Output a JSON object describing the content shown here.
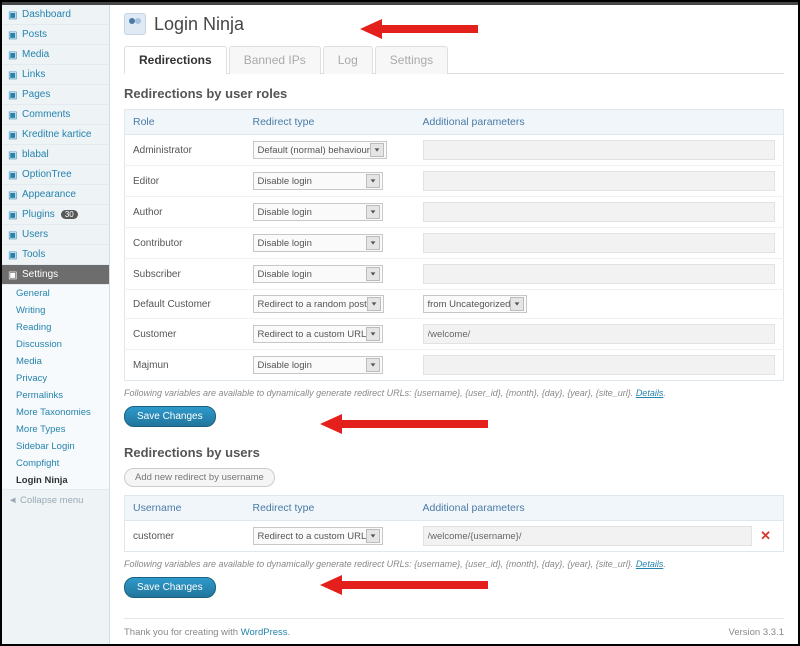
{
  "sidebar": {
    "items": [
      {
        "label": "Dashboard",
        "icon": "home-icon"
      },
      {
        "label": "Posts",
        "icon": "pin-icon"
      },
      {
        "label": "Media",
        "icon": "media-icon"
      },
      {
        "label": "Links",
        "icon": "link-icon"
      },
      {
        "label": "Pages",
        "icon": "page-icon"
      },
      {
        "label": "Comments",
        "icon": "comment-icon"
      },
      {
        "label": "Kreditne kartice",
        "icon": "card-icon"
      },
      {
        "label": "blabal",
        "icon": "generic-icon"
      },
      {
        "label": "OptionTree",
        "icon": "tree-icon"
      },
      {
        "label": "Appearance",
        "icon": "appearance-icon"
      },
      {
        "label": "Plugins",
        "icon": "plugin-icon",
        "badge": "30"
      },
      {
        "label": "Users",
        "icon": "users-icon"
      },
      {
        "label": "Tools",
        "icon": "tools-icon"
      },
      {
        "label": "Settings",
        "icon": "settings-icon",
        "active": true
      }
    ],
    "subitems": [
      "General",
      "Writing",
      "Reading",
      "Discussion",
      "Media",
      "Privacy",
      "Permalinks",
      "More Taxonomies",
      "More Types",
      "Sidebar Login",
      "Compfight",
      "Login Ninja"
    ],
    "subitem_current_index": 11,
    "collapse_label": "Collapse menu"
  },
  "page": {
    "title": "Login Ninja"
  },
  "tabs": [
    "Redirections",
    "Banned IPs",
    "Log",
    "Settings"
  ],
  "active_tab_index": 0,
  "section_roles": {
    "heading": "Redirections by user roles",
    "columns": {
      "role": "Role",
      "type": "Redirect type",
      "params": "Additional parameters"
    },
    "rows": [
      {
        "role": "Administrator",
        "type": "Default (normal) behaviour",
        "param": ""
      },
      {
        "role": "Editor",
        "type": "Disable login",
        "param": ""
      },
      {
        "role": "Author",
        "type": "Disable login",
        "param": ""
      },
      {
        "role": "Contributor",
        "type": "Disable login",
        "param": ""
      },
      {
        "role": "Subscriber",
        "type": "Disable login",
        "param": ""
      },
      {
        "role": "Default Customer",
        "type": "Redirect to a random post",
        "param": "from Uncategorized",
        "param_is_select": true
      },
      {
        "role": "Customer",
        "type": "Redirect to a custom URL",
        "param": "/welcome/"
      },
      {
        "role": "Majmun",
        "type": "Disable login",
        "param": ""
      }
    ],
    "hint_prefix": "Following variables are available to dynamically generate redirect URLs: {username}, {user_id}, {month}, {day}, {year}, {site_url}. ",
    "hint_link": "Details",
    "save_label": "Save Changes"
  },
  "section_users": {
    "heading": "Redirections by users",
    "add_btn": "Add new redirect by username",
    "columns": {
      "user": "Username",
      "type": "Redirect type",
      "params": "Additional parameters"
    },
    "rows": [
      {
        "user": "customer",
        "type": "Redirect to a custom URL",
        "param": "/welcome/{username}/",
        "deletable": true
      }
    ],
    "hint_prefix": "Following variables are available to dynamically generate redirect URLs: {username}, {user_id}, {month}, {day}, {year}, {site_url}. ",
    "hint_link": "Details",
    "save_label": "Save Changes"
  },
  "footer": {
    "thanks_prefix": "Thank you for creating with ",
    "thanks_link": "WordPress",
    "thanks_suffix": ".",
    "version": "Version 3.3.1"
  }
}
